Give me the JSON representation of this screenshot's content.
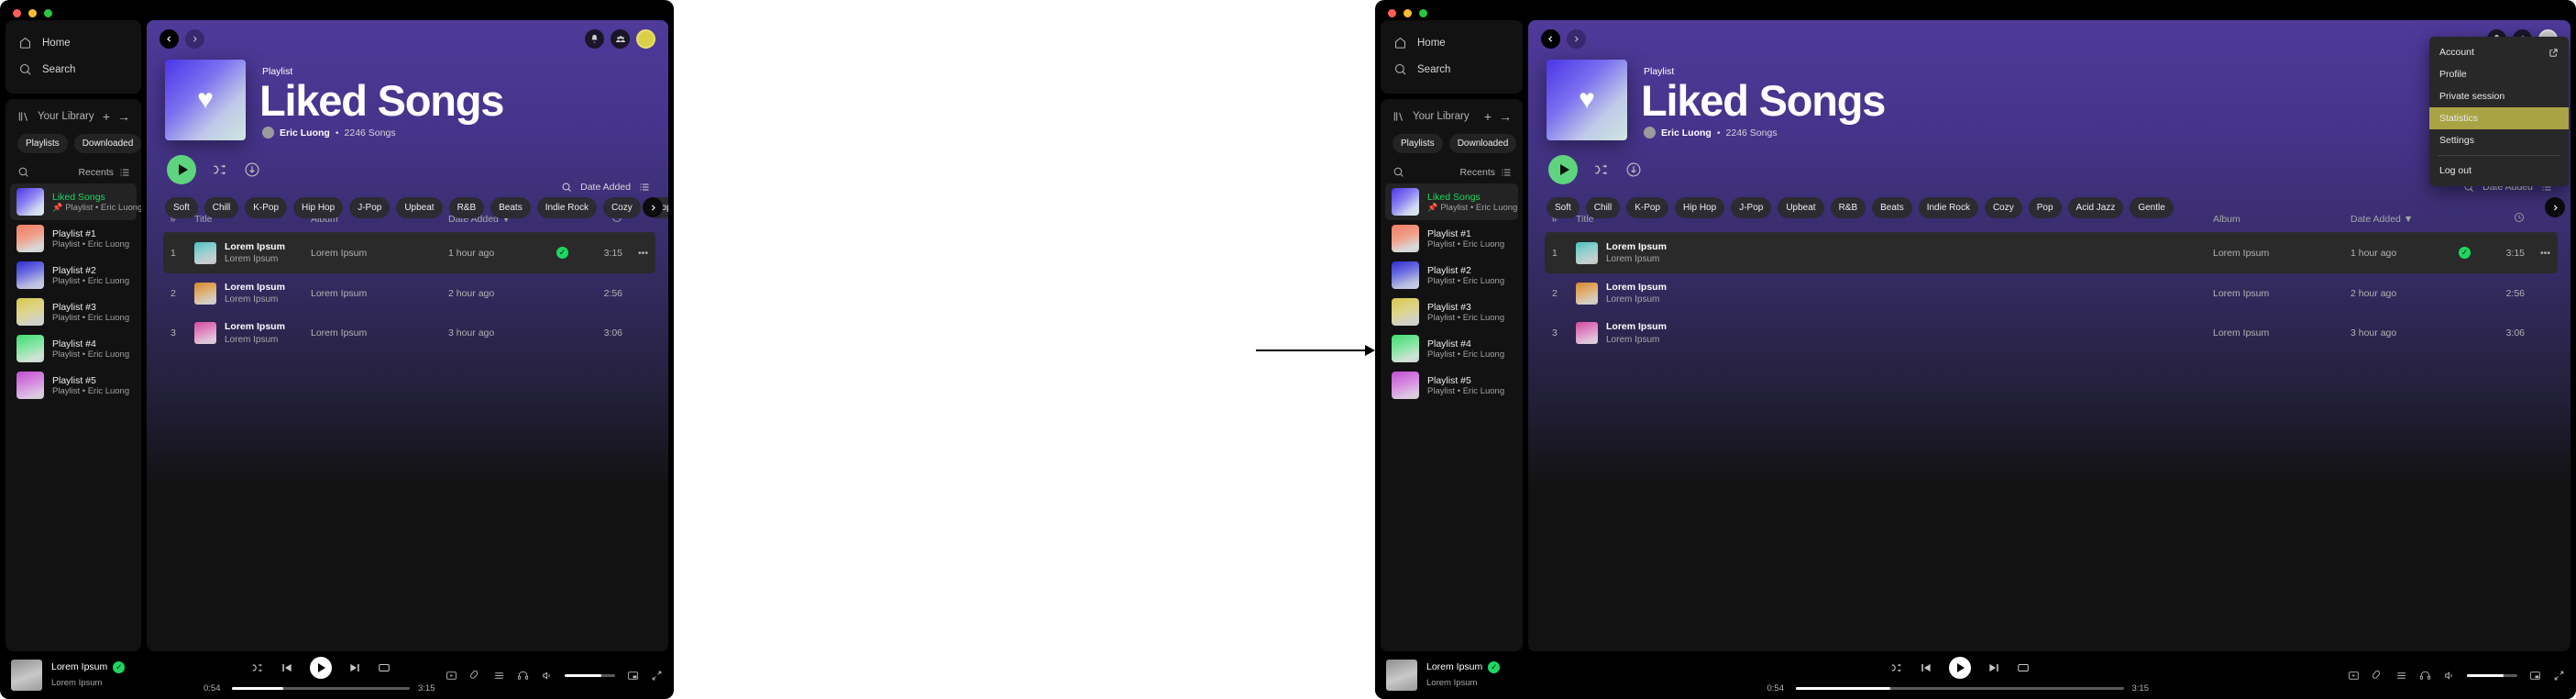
{
  "app": {
    "window_controls": [
      "close",
      "minimize",
      "maximize"
    ]
  },
  "sidebar": {
    "nav": [
      {
        "label": "Home",
        "icon": "home-icon"
      },
      {
        "label": "Search",
        "icon": "search-icon"
      }
    ],
    "library": {
      "label": "Your Library",
      "icon": "library-icon",
      "add_label": "+",
      "expand_label": "→",
      "filter_chips": [
        "Playlists",
        "Downloaded"
      ],
      "search_icon": "search-icon",
      "sort_label": "Recents",
      "sort_icon": "list-view-icon"
    },
    "playlists": [
      {
        "title": "Liked Songs",
        "subtitle": "Playlist • Eric Luong",
        "pinned": true,
        "active": true,
        "art": "linear-gradient(140deg,#4b35e8,#8f86f2 45%,#cfd8f0 75%,#dfeee9)"
      },
      {
        "title": "Playlist #1",
        "subtitle": "Playlist • Eric Luong",
        "pinned": false,
        "active": false,
        "art": "linear-gradient(160deg,#ef7d62,#f0a08a 45%,#d9d9d9 80%,#cfcfcf)"
      },
      {
        "title": "Playlist #2",
        "subtitle": "Playlist • Eric Luong",
        "pinned": false,
        "active": false,
        "art": "linear-gradient(160deg,#2c2fd0,#6d6fe0 40%,#b9bce0 75%,#cfd3e8)"
      },
      {
        "title": "Playlist #3",
        "subtitle": "Playlist • Eric Luong",
        "pinned": false,
        "active": false,
        "art": "linear-gradient(160deg,#d7c94a,#ded48a 45%,#d2d2c8 80%,#cfcfcf)"
      },
      {
        "title": "Playlist #4",
        "subtitle": "Playlist • Eric Luong",
        "pinned": false,
        "active": false,
        "art": "linear-gradient(160deg,#3ddc6f,#86e7a4 45%,#cfe3d6 80%,#cfcfcf)"
      },
      {
        "title": "Playlist #5",
        "subtitle": "Playlist • Eric Luong",
        "pinned": false,
        "active": false,
        "art": "linear-gradient(160deg,#c04fd0,#d68ae0 45%,#dcc6e3 80%,#cfcfcf)"
      }
    ]
  },
  "topbar": {
    "back_icon": "chevron-left-icon",
    "forward_icon": "chevron-right-icon",
    "notification_icon": "bell-icon",
    "friends_icon": "friends-icon",
    "avatar_icon": "avatar"
  },
  "hero": {
    "kicker": "Playlist",
    "title": "Liked Songs",
    "owner": "Eric Luong",
    "separator": "•",
    "song_count": "2246 Songs",
    "cover_icon": "heart-icon"
  },
  "actions": {
    "play_label": "Play",
    "shuffle_icon": "shuffle-icon",
    "download_icon": "download-circle-icon"
  },
  "genres": [
    "Soft",
    "Chill",
    "K-Pop",
    "Hip Hop",
    "J-Pop",
    "Upbeat",
    "R&B",
    "Beats",
    "Indie Rock",
    "Cozy",
    "Pop",
    "Acid Jazz",
    "Gentle"
  ],
  "genres_next_icon": "chevron-right-icon",
  "sortbar": {
    "search_icon": "search-icon",
    "sort_label": "Date Added",
    "view_icon": "list-view-icon"
  },
  "table": {
    "headers": {
      "num": "#",
      "title": "Title",
      "album": "Album",
      "date": "Date Added",
      "duration_icon": "clock-icon"
    },
    "sort_arrow": "▼",
    "rows": [
      {
        "num": "1",
        "title": "Lorem Ipsum",
        "artist": "Lorem Ipsum",
        "album": "Lorem Ipsum",
        "date": "1 hour ago",
        "liked": true,
        "duration": "3:15",
        "more": "•••",
        "selected": true,
        "art": "linear-gradient(160deg,#4bbfbf,#8fd0cf 40%,#c9cfcf 80%,#bdbdbd)"
      },
      {
        "num": "2",
        "title": "Lorem Ipsum",
        "artist": "Lorem Ipsum",
        "album": "Lorem Ipsum",
        "date": "2 hour ago",
        "liked": false,
        "duration": "2:56",
        "more": "",
        "selected": false,
        "art": "linear-gradient(160deg,#d08a30,#e0ad6c 40%,#d4cfc4 80%,#c9c9c9)"
      },
      {
        "num": "3",
        "title": "Lorem Ipsum",
        "artist": "Lorem Ipsum",
        "album": "Lorem Ipsum",
        "date": "3 hour ago",
        "liked": false,
        "duration": "3:06",
        "more": "",
        "selected": false,
        "art": "linear-gradient(160deg,#d04b9e,#e085c0 40%,#e0c6da 80%,#cfcfcf)"
      }
    ]
  },
  "player": {
    "track_title": "Lorem Ipsum",
    "track_artist": "Lorem Ipsum",
    "liked": true,
    "elapsed": "0:54",
    "total": "3:15",
    "progress_percent": 29,
    "volume_percent": 72,
    "controls": {
      "shuffle_icon": "shuffle-icon",
      "previous_icon": "previous-track-icon",
      "play_icon": "play-icon",
      "next_icon": "next-track-icon",
      "repeat_icon": "repeat-icon"
    },
    "right_controls": {
      "now_playing_view_icon": "now-playing-view-icon",
      "lyrics_icon": "lyrics-icon",
      "queue_icon": "queue-icon",
      "connect_device_icon": "headphones-icon",
      "volume_icon": "volume-icon",
      "miniplayer_icon": "miniplayer-icon",
      "fullscreen_icon": "fullscreen-icon"
    }
  },
  "dropdown": {
    "items": [
      {
        "label": "Account",
        "external": true,
        "highlight": false,
        "divider_after": false
      },
      {
        "label": "Profile",
        "external": false,
        "highlight": false,
        "divider_after": false
      },
      {
        "label": "Private session",
        "external": false,
        "highlight": false,
        "divider_after": false
      },
      {
        "label": "Statistics",
        "external": false,
        "highlight": true,
        "divider_after": false
      },
      {
        "label": "Settings",
        "external": false,
        "highlight": false,
        "divider_after": true
      },
      {
        "label": "Log out",
        "external": false,
        "highlight": false,
        "divider_after": false
      }
    ],
    "external_icon": "external-link-icon",
    "highlight_color": "#a9a345"
  },
  "transition": {
    "arrow_icon": "right-arrow-icon"
  }
}
